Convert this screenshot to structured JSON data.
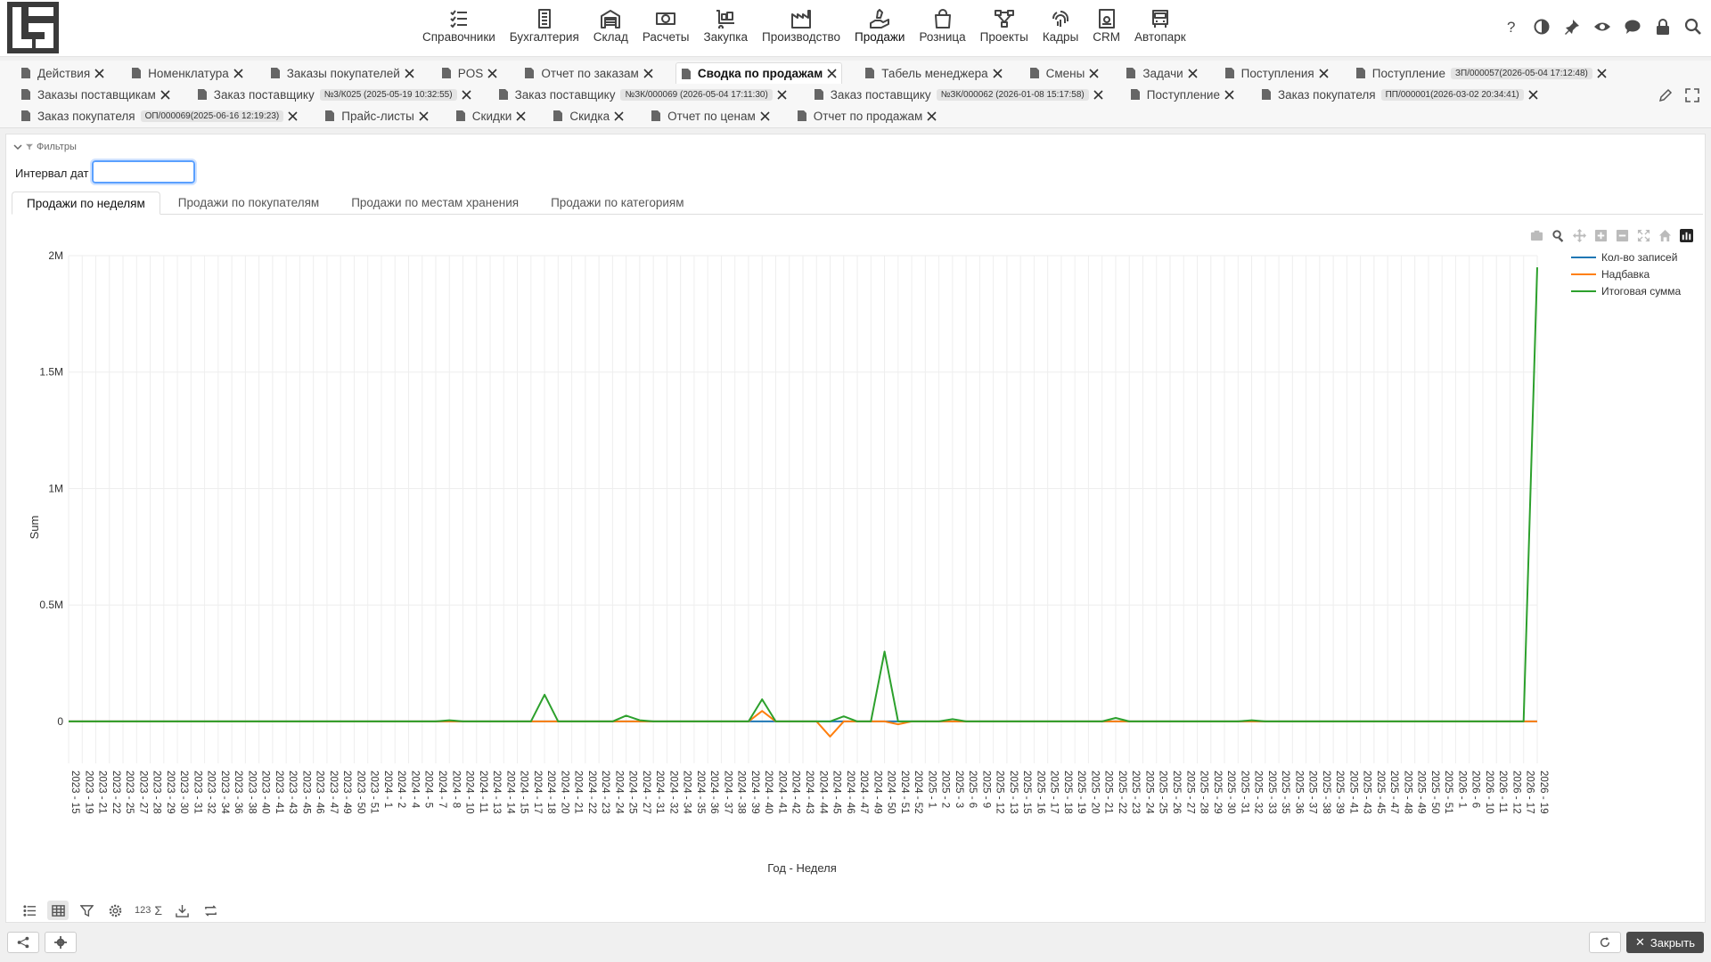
{
  "menu": [
    {
      "label": "Справочники",
      "icon": "list-check-icon"
    },
    {
      "label": "Бухгалтерия",
      "icon": "ledger-icon"
    },
    {
      "label": "Склад",
      "icon": "warehouse-icon"
    },
    {
      "label": "Расчеты",
      "icon": "money-icon"
    },
    {
      "label": "Закупка",
      "icon": "dolly-icon"
    },
    {
      "label": "Производство",
      "icon": "factory-icon"
    },
    {
      "label": "Продажи",
      "icon": "hand-holding-icon",
      "active": true
    },
    {
      "label": "Розница",
      "icon": "bag-icon"
    },
    {
      "label": "Проекты",
      "icon": "diagram-icon"
    },
    {
      "label": "Кадры",
      "icon": "fingerprint-icon"
    },
    {
      "label": "CRM",
      "icon": "id-card-icon"
    },
    {
      "label": "Автопарк",
      "icon": "bus-icon"
    }
  ],
  "tabs_row1": [
    {
      "label": "Действия"
    },
    {
      "label": "Номенклатура"
    },
    {
      "label": "Заказы покупателей"
    },
    {
      "label": "POS"
    },
    {
      "label": "Отчет по заказам"
    },
    {
      "label": "Сводка по продажам",
      "active": true
    },
    {
      "label": "Табель менеджера"
    },
    {
      "label": "Смены"
    },
    {
      "label": "Задачи"
    },
    {
      "label": "Поступления"
    },
    {
      "label": "Поступление",
      "badge": "ЗП/000057(2026-05-04 17:12:48)"
    }
  ],
  "tabs_row2": [
    {
      "label": "Заказы поставщикам"
    },
    {
      "label": "Заказ поставщику",
      "badge": "№3/К025 (2025-05-19 10:32:55)"
    },
    {
      "label": "Заказ поставщику",
      "badge": "№ЗК/000069 (2026-05-04 17:11:30)"
    },
    {
      "label": "Заказ поставщику",
      "badge": "№ЗК/000062 (2026-01-08 15:17:58)"
    },
    {
      "label": "Поступление"
    },
    {
      "label": "Заказ покупателя",
      "badge": "ПП/000001(2026-03-02 20:34:41)"
    }
  ],
  "tabs_row3": [
    {
      "label": "Заказ покупателя",
      "badge": "ОП/000069(2025-06-16 12:19:23)"
    },
    {
      "label": "Прайс-листы"
    },
    {
      "label": "Скидки"
    },
    {
      "label": "Скидка"
    },
    {
      "label": "Отчет по ценам"
    },
    {
      "label": "Отчет по продажам"
    }
  ],
  "filters": {
    "toggle_label": "Фильтры",
    "date_label": "Интервал дат",
    "date_value": ""
  },
  "subtabs": [
    {
      "label": "Продажи по неделям",
      "active": true
    },
    {
      "label": "Продажи по покупателям"
    },
    {
      "label": "Продажи по местам хранения"
    },
    {
      "label": "Продажи по категориям"
    }
  ],
  "footer": {
    "close_label": "Закрыть"
  },
  "bottom_tools": {
    "number_label": "123"
  },
  "colors": {
    "blue": "#1f77b4",
    "orange": "#ff7f0e",
    "green": "#2ca02c"
  },
  "chart_data": {
    "type": "line",
    "xlabel": "Год - Неделя",
    "ylabel": "Sum",
    "ylim": [
      -180000,
      2000000
    ],
    "yticks": [
      {
        "v": 0,
        "label": "0"
      },
      {
        "v": 500000,
        "label": "0.5M"
      },
      {
        "v": 1000000,
        "label": "1M"
      },
      {
        "v": 1500000,
        "label": "1.5M"
      },
      {
        "v": 2000000,
        "label": "2M"
      }
    ],
    "legend_position": "top-right",
    "grid": true,
    "categories": [
      "2023 - 15",
      "2023 - 19",
      "2023 - 21",
      "2023 - 22",
      "2023 - 25",
      "2023 - 27",
      "2023 - 28",
      "2023 - 29",
      "2023 - 30",
      "2023 - 31",
      "2023 - 32",
      "2023 - 34",
      "2023 - 36",
      "2023 - 38",
      "2023 - 40",
      "2023 - 41",
      "2023 - 43",
      "2023 - 45",
      "2023 - 46",
      "2023 - 47",
      "2023 - 49",
      "2023 - 50",
      "2023 - 51",
      "2024 - 1",
      "2024 - 2",
      "2024 - 4",
      "2024 - 5",
      "2024 - 7",
      "2024 - 8",
      "2024 - 10",
      "2024 - 11",
      "2024 - 13",
      "2024 - 14",
      "2024 - 15",
      "2024 - 17",
      "2024 - 18",
      "2024 - 20",
      "2024 - 21",
      "2024 - 22",
      "2024 - 23",
      "2024 - 24",
      "2024 - 25",
      "2024 - 27",
      "2024 - 31",
      "2024 - 32",
      "2024 - 34",
      "2024 - 35",
      "2024 - 36",
      "2024 - 37",
      "2024 - 38",
      "2024 - 39",
      "2024 - 40",
      "2024 - 41",
      "2024 - 42",
      "2024 - 43",
      "2024 - 44",
      "2024 - 45",
      "2024 - 46",
      "2024 - 47",
      "2024 - 49",
      "2024 - 50",
      "2024 - 51",
      "2024 - 52",
      "2025 - 1",
      "2025 - 2",
      "2025 - 3",
      "2025 - 6",
      "2025 - 9",
      "2025 - 12",
      "2025 - 13",
      "2025 - 15",
      "2025 - 16",
      "2025 - 17",
      "2025 - 18",
      "2025 - 19",
      "2025 - 20",
      "2025 - 21",
      "2025 - 22",
      "2025 - 23",
      "2025 - 24",
      "2025 - 25",
      "2025 - 26",
      "2025 - 27",
      "2025 - 28",
      "2025 - 29",
      "2025 - 30",
      "2025 - 31",
      "2025 - 32",
      "2025 - 33",
      "2025 - 35",
      "2025 - 36",
      "2025 - 37",
      "2025 - 38",
      "2025 - 39",
      "2025 - 41",
      "2025 - 43",
      "2025 - 45",
      "2025 - 47",
      "2025 - 48",
      "2025 - 49",
      "2025 - 50",
      "2025 - 51",
      "2026 - 1",
      "2026 - 6",
      "2026 - 10",
      "2026 - 11",
      "2026 - 12",
      "2026 - 17",
      "2026 - 19"
    ],
    "series": [
      {
        "name": "Кол-во записей",
        "color": "#1f77b4",
        "values": [
          0,
          0,
          0,
          0,
          0,
          0,
          0,
          0,
          0,
          0,
          0,
          0,
          0,
          0,
          0,
          0,
          0,
          0,
          0,
          0,
          0,
          0,
          0,
          0,
          0,
          0,
          0,
          0,
          0,
          0,
          0,
          0,
          0,
          0,
          0,
          0,
          0,
          0,
          0,
          0,
          0,
          0,
          0,
          0,
          0,
          0,
          0,
          0,
          0,
          0,
          0,
          0,
          0,
          0,
          0,
          0,
          0,
          0,
          0,
          0,
          0,
          0,
          0,
          0,
          0,
          0,
          0,
          0,
          0,
          0,
          0,
          0,
          0,
          0,
          0,
          0,
          0,
          0,
          0,
          0,
          0,
          0,
          0,
          0,
          0,
          0,
          0,
          0,
          0,
          0,
          0,
          0,
          0,
          0,
          0,
          0,
          0,
          0,
          0,
          0,
          0,
          0,
          0,
          0,
          0,
          0,
          0,
          0,
          0
        ]
      },
      {
        "name": "Надбавка",
        "color": "#ff7f0e",
        "values": [
          0,
          0,
          0,
          0,
          0,
          0,
          0,
          0,
          0,
          0,
          0,
          0,
          0,
          0,
          0,
          0,
          0,
          0,
          0,
          0,
          0,
          0,
          0,
          0,
          0,
          0,
          0,
          0,
          0,
          0,
          0,
          0,
          0,
          0,
          0,
          0,
          0,
          0,
          0,
          0,
          0,
          0,
          0,
          0,
          0,
          0,
          0,
          0,
          0,
          0,
          0,
          45000,
          0,
          0,
          0,
          0,
          -65000,
          0,
          0,
          0,
          0,
          -12000,
          0,
          0,
          0,
          0,
          0,
          0,
          0,
          0,
          0,
          0,
          0,
          0,
          0,
          0,
          0,
          0,
          0,
          0,
          0,
          0,
          0,
          0,
          0,
          0,
          0,
          0,
          0,
          0,
          0,
          0,
          0,
          0,
          0,
          0,
          0,
          0,
          0,
          0,
          0,
          0,
          0,
          0,
          0,
          0,
          0,
          0,
          0
        ]
      },
      {
        "name": "Итоговая сумма",
        "color": "#2ca02c",
        "values": [
          0,
          0,
          0,
          0,
          0,
          0,
          0,
          0,
          0,
          0,
          0,
          0,
          0,
          0,
          0,
          0,
          0,
          0,
          0,
          0,
          0,
          0,
          0,
          0,
          0,
          0,
          0,
          0,
          5000,
          0,
          0,
          0,
          0,
          0,
          0,
          115000,
          0,
          0,
          0,
          0,
          0,
          25000,
          5000,
          0,
          0,
          0,
          0,
          0,
          0,
          0,
          0,
          95000,
          0,
          0,
          0,
          0,
          0,
          22000,
          0,
          0,
          300000,
          0,
          0,
          0,
          0,
          10000,
          0,
          0,
          0,
          0,
          0,
          0,
          0,
          0,
          0,
          0,
          0,
          15000,
          0,
          0,
          0,
          0,
          0,
          0,
          0,
          0,
          0,
          5000,
          0,
          0,
          0,
          0,
          0,
          0,
          0,
          0,
          0,
          0,
          0,
          0,
          0,
          0,
          0,
          0,
          0,
          0,
          0,
          0,
          1950000
        ]
      }
    ]
  }
}
